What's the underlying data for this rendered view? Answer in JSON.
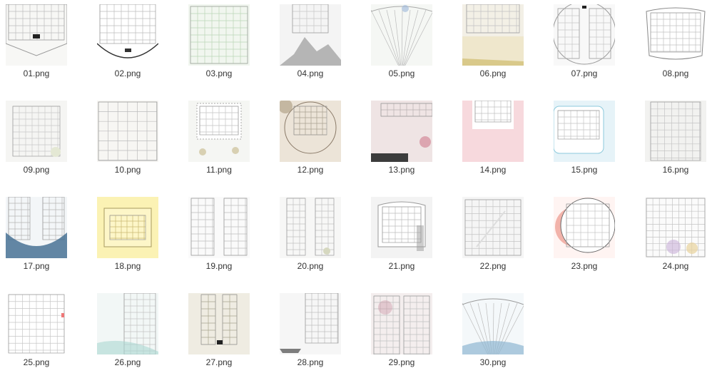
{
  "files": [
    {
      "name": "01.png",
      "style": "scallop-top",
      "bg": "#f7f7f5",
      "accent": "#222222"
    },
    {
      "name": "02.png",
      "style": "fan-bottom",
      "bg": "#ffffff",
      "accent": "#333333"
    },
    {
      "name": "03.png",
      "style": "plain-green",
      "bg": "#f1f6ef",
      "accent": "#b9d6b6"
    },
    {
      "name": "04.png",
      "style": "mountain",
      "bg": "#f4f4f4",
      "accent": "#7a7a7a"
    },
    {
      "name": "05.png",
      "style": "fan-top",
      "bg": "#f5f7f4",
      "accent": "#9bb5d9"
    },
    {
      "name": "06.png",
      "style": "sunset",
      "bg": "#f3f0e6",
      "accent": "#d9c98a"
    },
    {
      "name": "07.png",
      "style": "circle-split",
      "bg": "#f8f8f8",
      "accent": "#222222"
    },
    {
      "name": "08.png",
      "style": "arch",
      "bg": "#ffffff",
      "accent": "#555555"
    },
    {
      "name": "09.png",
      "style": "floral",
      "bg": "#f5f5f3",
      "accent": "#c7c7c0"
    },
    {
      "name": "10.png",
      "style": "plain",
      "bg": "#f7f6f3",
      "accent": "#bcbcbc"
    },
    {
      "name": "11.png",
      "style": "stamp",
      "bg": "#f5f6f3",
      "accent": "#b0b0a8"
    },
    {
      "name": "12.png",
      "style": "autumn",
      "bg": "#ece4d8",
      "accent": "#8a7a68"
    },
    {
      "name": "13.png",
      "style": "blossom",
      "bg": "#efe4e4",
      "accent": "#d48a9a"
    },
    {
      "name": "14.png",
      "style": "pink-box",
      "bg": "#f7d9dd",
      "accent": "#e8a8b2"
    },
    {
      "name": "15.png",
      "style": "blue-frame",
      "bg": "#e6f3f8",
      "accent": "#8cc9dc"
    },
    {
      "name": "16.png",
      "style": "marble",
      "bg": "#f2f2f0",
      "accent": "#bdbdb8"
    },
    {
      "name": "17.png",
      "style": "ocean",
      "bg": "#f3f6f8",
      "accent": "#3d6a8f"
    },
    {
      "name": "18.png",
      "style": "yellow",
      "bg": "#fbf2b4",
      "accent": "#d9c26a"
    },
    {
      "name": "19.png",
      "style": "columns",
      "bg": "#fafafa",
      "accent": "#bbbbbb"
    },
    {
      "name": "20.png",
      "style": "columns-flower",
      "bg": "#f7f7f6",
      "accent": "#bcbcbc"
    },
    {
      "name": "21.png",
      "style": "cloud",
      "bg": "#f3f3f3",
      "accent": "#9a9a9a"
    },
    {
      "name": "22.png",
      "style": "scribble",
      "bg": "#f5f5f5",
      "accent": "#b5b5b5"
    },
    {
      "name": "23.png",
      "style": "red-circle",
      "bg": "#fff4f2",
      "accent": "#e58072"
    },
    {
      "name": "24.png",
      "style": "kids",
      "bg": "#fbfbfb",
      "accent": "#c9b0d8"
    },
    {
      "name": "25.png",
      "style": "lined",
      "bg": "#ffffff",
      "accent": "#bfbfbf"
    },
    {
      "name": "26.png",
      "style": "teal",
      "bg": "#f2f7f6",
      "accent": "#aad7d2"
    },
    {
      "name": "27.png",
      "style": "beige-split",
      "bg": "#efece2",
      "accent": "#222222"
    },
    {
      "name": "28.png",
      "style": "boat",
      "bg": "#f6f6f6",
      "accent": "#7d7d7d"
    },
    {
      "name": "29.png",
      "style": "ink-wash",
      "bg": "#f4eeee",
      "accent": "#c98f9f"
    },
    {
      "name": "30.png",
      "style": "fan-blue",
      "bg": "#f4f8fa",
      "accent": "#8fb6d2"
    }
  ]
}
